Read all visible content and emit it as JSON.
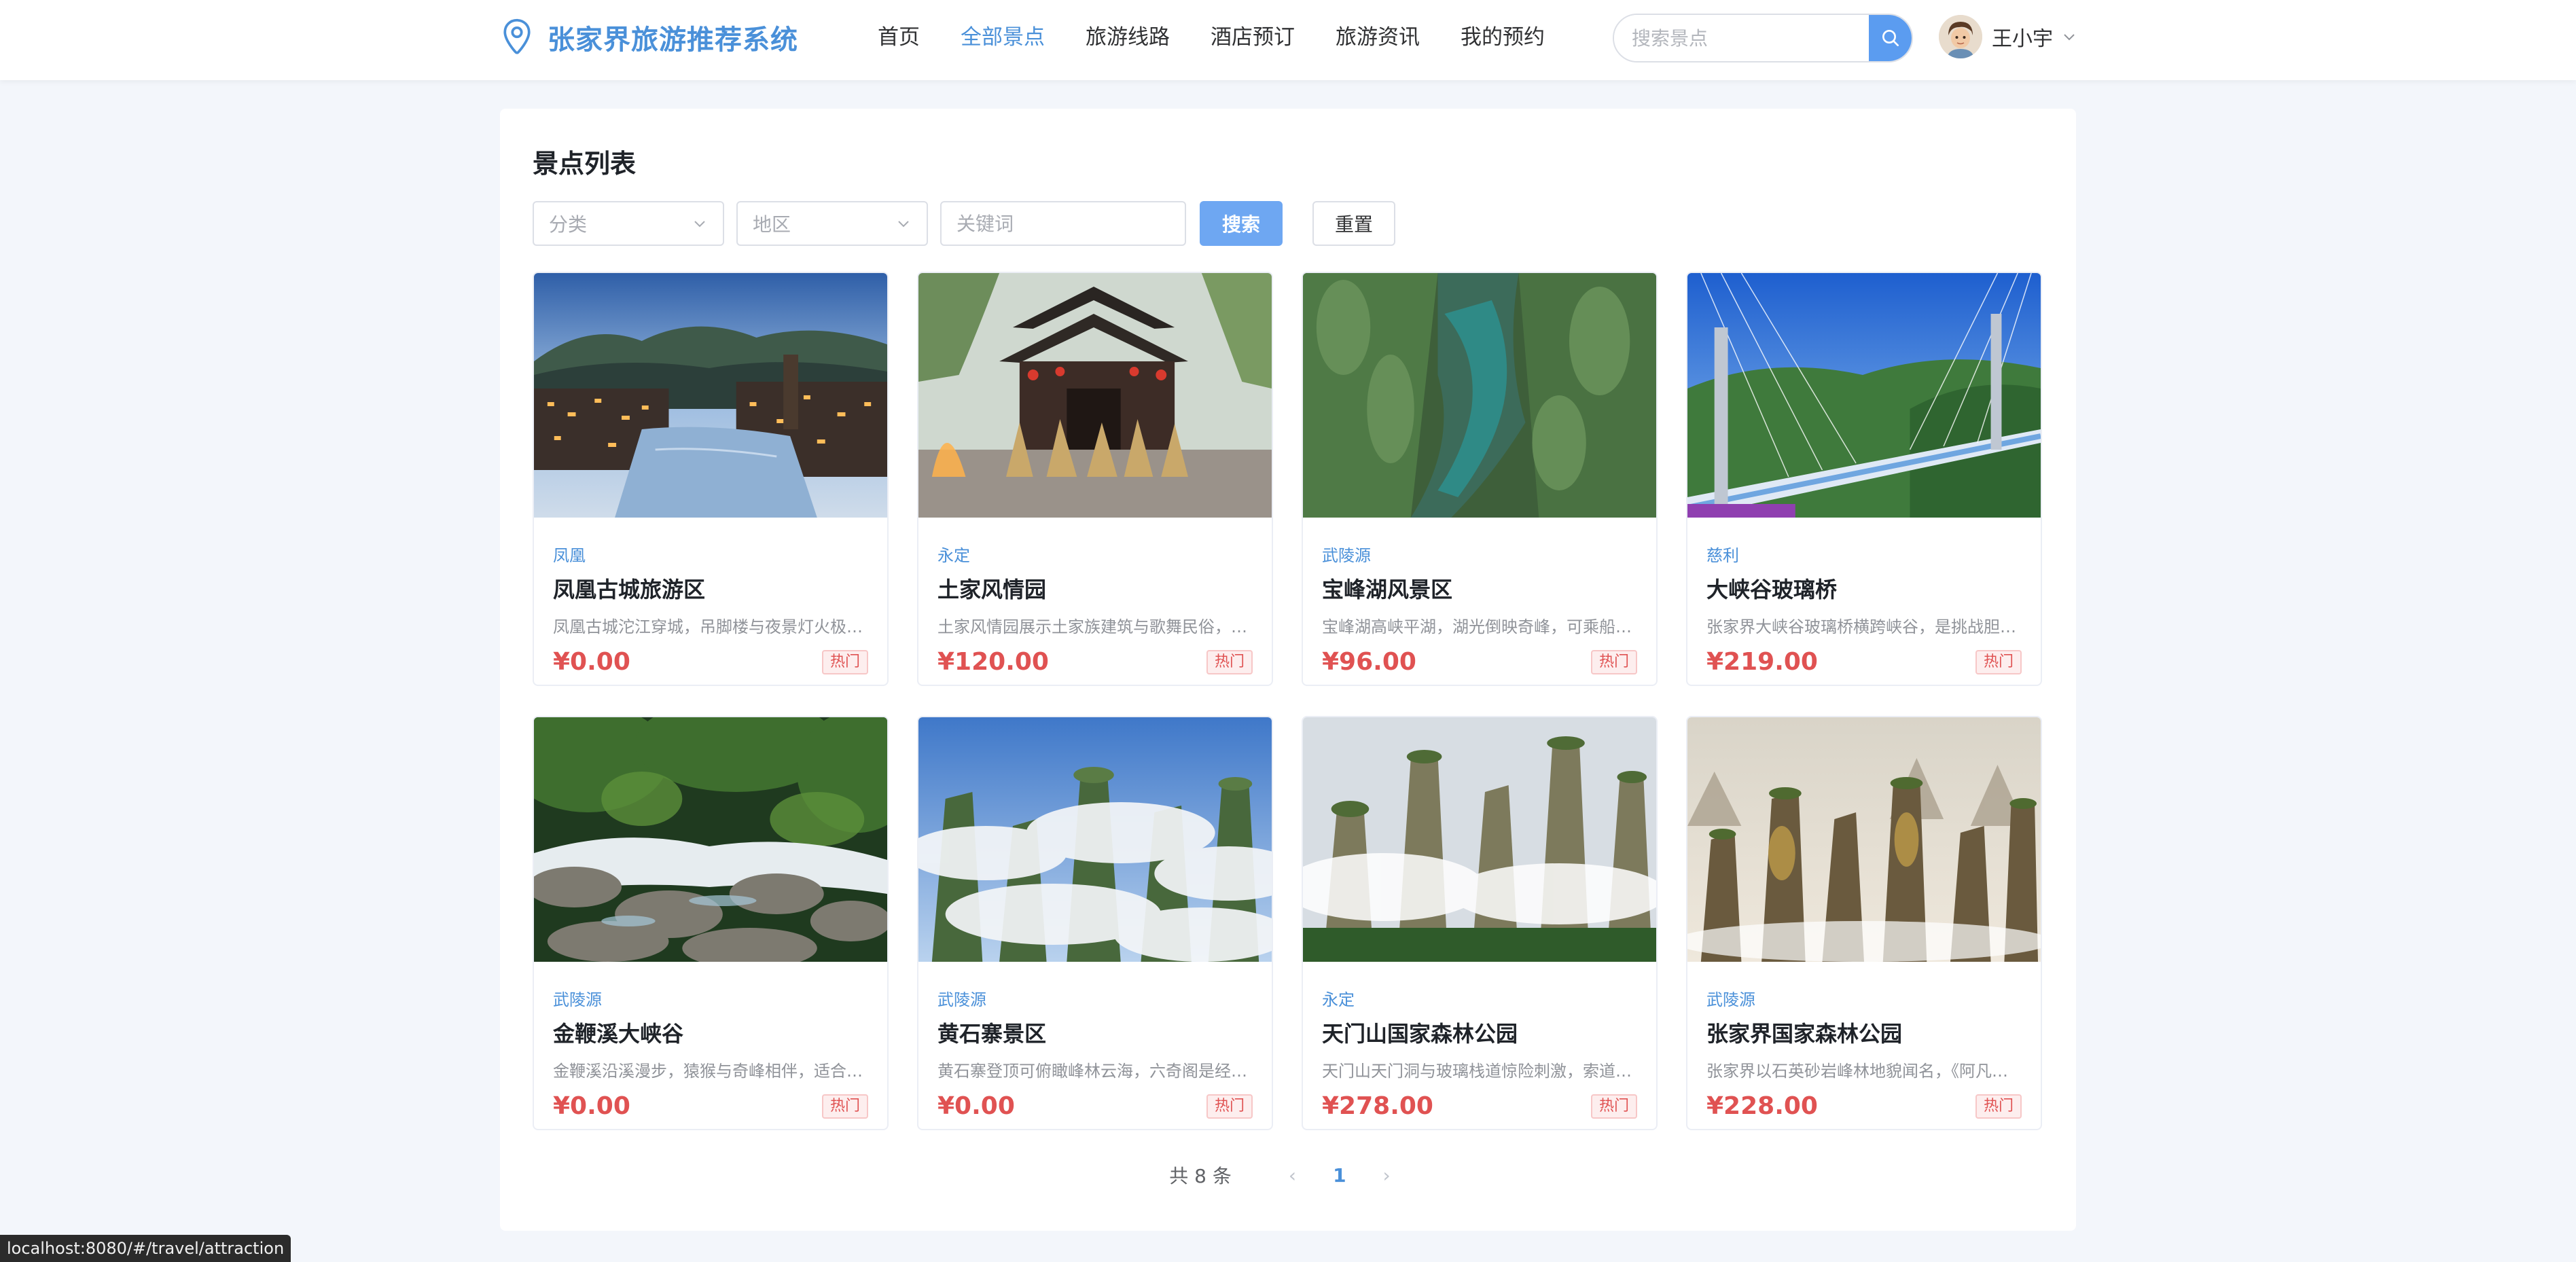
{
  "header": {
    "app_title": "张家界旅游推荐系统",
    "nav": [
      {
        "label": "首页",
        "active": false
      },
      {
        "label": "全部景点",
        "active": true
      },
      {
        "label": "旅游线路",
        "active": false
      },
      {
        "label": "酒店预订",
        "active": false
      },
      {
        "label": "旅游资讯",
        "active": false
      },
      {
        "label": "我的预约",
        "active": false
      }
    ],
    "search_placeholder": "搜索景点",
    "user_name": "王小宇",
    "brand_color": "#4a90d9"
  },
  "main": {
    "title": "景点列表",
    "filters": {
      "category_placeholder": "分类",
      "region_placeholder": "地区",
      "keyword_placeholder": "关键词",
      "search_label": "搜索",
      "reset_label": "重置"
    },
    "attractions": [
      {
        "region": "凤凰",
        "name": "凤凰古城旅游区",
        "desc": "凤凰古城沱江穿城，吊脚楼与夜景灯火极…",
        "price": "¥0.00",
        "tag": "热门",
        "image": "fenghuang-ancient-town"
      },
      {
        "region": "永定",
        "name": "土家风情园",
        "desc": "土家风情园展示土家族建筑与歌舞民俗，…",
        "price": "¥120.00",
        "tag": "热门",
        "image": "tujia-folk-park"
      },
      {
        "region": "武陵源",
        "name": "宝峰湖风景区",
        "desc": "宝峰湖高峡平湖，湖光倒映奇峰，可乘船…",
        "price": "¥96.00",
        "tag": "热门",
        "image": "baofeng-lake"
      },
      {
        "region": "慈利",
        "name": "大峡谷玻璃桥",
        "desc": "张家界大峡谷玻璃桥横跨峡谷，是挑战胆…",
        "price": "¥219.00",
        "tag": "热门",
        "image": "glass-bridge"
      },
      {
        "region": "武陵源",
        "name": "金鞭溪大峡谷",
        "desc": "金鞭溪沿溪漫步，猿猴与奇峰相伴，适合…",
        "price": "¥0.00",
        "tag": "热门",
        "image": "jinbian-stream"
      },
      {
        "region": "武陵源",
        "name": "黄石寨景区",
        "desc": "黄石寨登顶可俯瞰峰林云海，六奇阁是经…",
        "price": "¥0.00",
        "tag": "热门",
        "image": "huangshi-village"
      },
      {
        "region": "永定",
        "name": "天门山国家森林公园",
        "desc": "天门山天门洞与玻璃栈道惊险刺激，索道…",
        "price": "¥278.00",
        "tag": "热门",
        "image": "tianmen-mountain"
      },
      {
        "region": "武陵源",
        "name": "张家界国家森林公园",
        "desc": "张家界以石英砂岩峰林地貌闻名，《阿凡…",
        "price": "¥228.00",
        "tag": "热门",
        "image": "zhangjiajie-forest-park"
      }
    ],
    "pagination": {
      "total_text": "共 8 条",
      "current_page": "1",
      "prev_icon": "‹",
      "next_icon": "›"
    }
  },
  "statusbar": {
    "url": "localhost:8080/#/travel/attraction"
  }
}
